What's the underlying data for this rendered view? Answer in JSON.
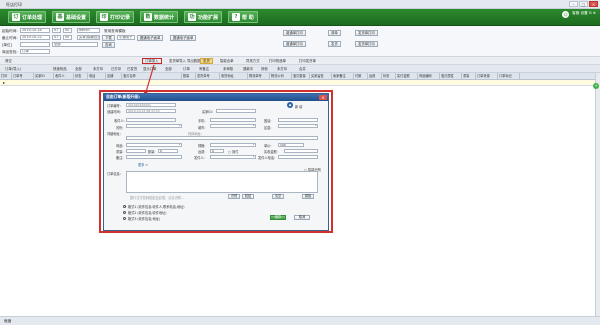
{
  "window": {
    "title": "旺店打印",
    "minimize": "–",
    "maximize": "□",
    "close": "×"
  },
  "nav": {
    "buttons": [
      {
        "label": "订单处理",
        "icon": "订"
      },
      {
        "label": "基础设置",
        "icon": "基"
      },
      {
        "label": "打印记录",
        "icon": "印"
      },
      {
        "label": "数据统计",
        "icon": "数"
      },
      {
        "label": "功能扩展",
        "icon": "功"
      },
      {
        "label": "帮  助",
        "icon": "?"
      }
    ],
    "right": {
      "icon": "☺",
      "text": "客服 设置 ⊟ ⊗"
    }
  },
  "filter": {
    "order_time_label": "起始时间:",
    "order_time_value": "2019-10-18",
    "order_time_h": "07",
    "order_time_m": "00",
    "order_time_end_label": "截止时间:",
    "order_time_end_value": "2019-10-22",
    "order_time_end_h": "07",
    "order_time_end_m": "00",
    "shop_label": "所有店铺",
    "shop_value": "admin",
    "status_label": "买家(模糊查找)",
    "common_query": "常用查询模板",
    "province_label": "省份",
    "customer_label": "快递",
    "sort_label": "[单位]",
    "sort_value": "全部",
    "amount_label": "订单金额",
    "print_status": "全部",
    "shipping_label": "[送达] 全部",
    "download_btn": "下载",
    "e_sheet_label": "中通电子",
    "e_sheet_btn": "圆通电子面单",
    "e_sheet_btn2": "圆通电子面单",
    "query_btn": "查询",
    "tpl1": "普通单打印",
    "tpl2": "普通单打印",
    "tpl3": "普通单打印",
    "tpl4": "普通单打印",
    "list_btn": "清单",
    "list_btn2": "发货",
    "batch1": "发货单打印",
    "batch2": "发货单打印",
    "goods_label": "商品查找:",
    "goods_value": "订单",
    "empty_btn": "清空"
  },
  "toolbar2": {
    "items": [
      "订单(导入)",
      "发货单导入",
      "导出数据",
      "异常方式",
      "复制",
      "收件人信息",
      "智能合单",
      "批量修改",
      "待审核",
      "添加备注",
      "批量设置",
      "标签",
      "打印快递单",
      "打印发货单"
    ],
    "highlighted": "订单录入",
    "selected": "发货"
  },
  "toolbar3": {
    "items": [
      "订单(导入)",
      "快递商品",
      "全部",
      "未打印",
      "已打印",
      "已打印",
      "已打印",
      "已发货",
      "全部",
      "显示订单",
      "全部",
      "全部",
      "订单",
      "有备注",
      "未审核",
      "退款中",
      "其他",
      "未打印",
      "全部",
      "合并"
    ]
  },
  "grid": {
    "headers": [
      "打印",
      "订单号",
      "买家ID",
      "收件人",
      "状态",
      "电话",
      "店铺",
      "宝贝名称",
      "数量",
      "发货单号",
      "收货地址",
      "物流单号",
      "物流公司",
      "宝贝数量",
      "买家留言",
      "卖家备注",
      "付款",
      "运费",
      "状态",
      "实付金额",
      "商品编码",
      "宝贝属性",
      "重量",
      "订单来源",
      "订单标记"
    ]
  },
  "dialog": {
    "title": "自由订单(新版升级)",
    "order_label": "订单编号:",
    "order_value": "201910220001",
    "time_label": "创建时间:",
    "time_value": "2019-10-22 08:21:51",
    "buyer_id_label": "买家ID:",
    "logo_text": "新 增",
    "recv_label": "收件人:",
    "phone_label": "手机:",
    "fixed_label": "固话:",
    "prov_label": "省份:",
    "city_label": "城市:",
    "dist_label": "区县:",
    "addr_label": "详细地址:",
    "addr_hint": "具体地址:",
    "goods_label": "商品:",
    "spec_label": "规格:",
    "count_label": "数量:",
    "price_label": "单价:",
    "price_value": "100",
    "weight_label": "重量:",
    "weight_value": "0",
    "freight_label": "运费:",
    "freight_value": "0",
    "cod_label": "□ 到付",
    "pay_label": "实收金额:",
    "memo_label": "备注:",
    "sender_label": "发件人:",
    "sender_phone_label": "发件人电话:",
    "more_label": "更多 >",
    "text_label": "订单信息:",
    "smart_label": "□ 智能识别",
    "paste_hint": "整行文字复制粘贴至此框，点击识别...",
    "btn_recognize": "识别",
    "btn_paste": "粘贴",
    "btn_clear": "清空",
    "btn_tpl": "模板",
    "radio1": "格式1 (收件信息:收件人,联系电话,地址)",
    "radio2": "格式2 (收件信息;收件地址)",
    "radio3": "格式3 (收件信息;地址)",
    "btn_save": "保存",
    "btn_cancel": "取消"
  },
  "status": {
    "text": "就绪"
  }
}
